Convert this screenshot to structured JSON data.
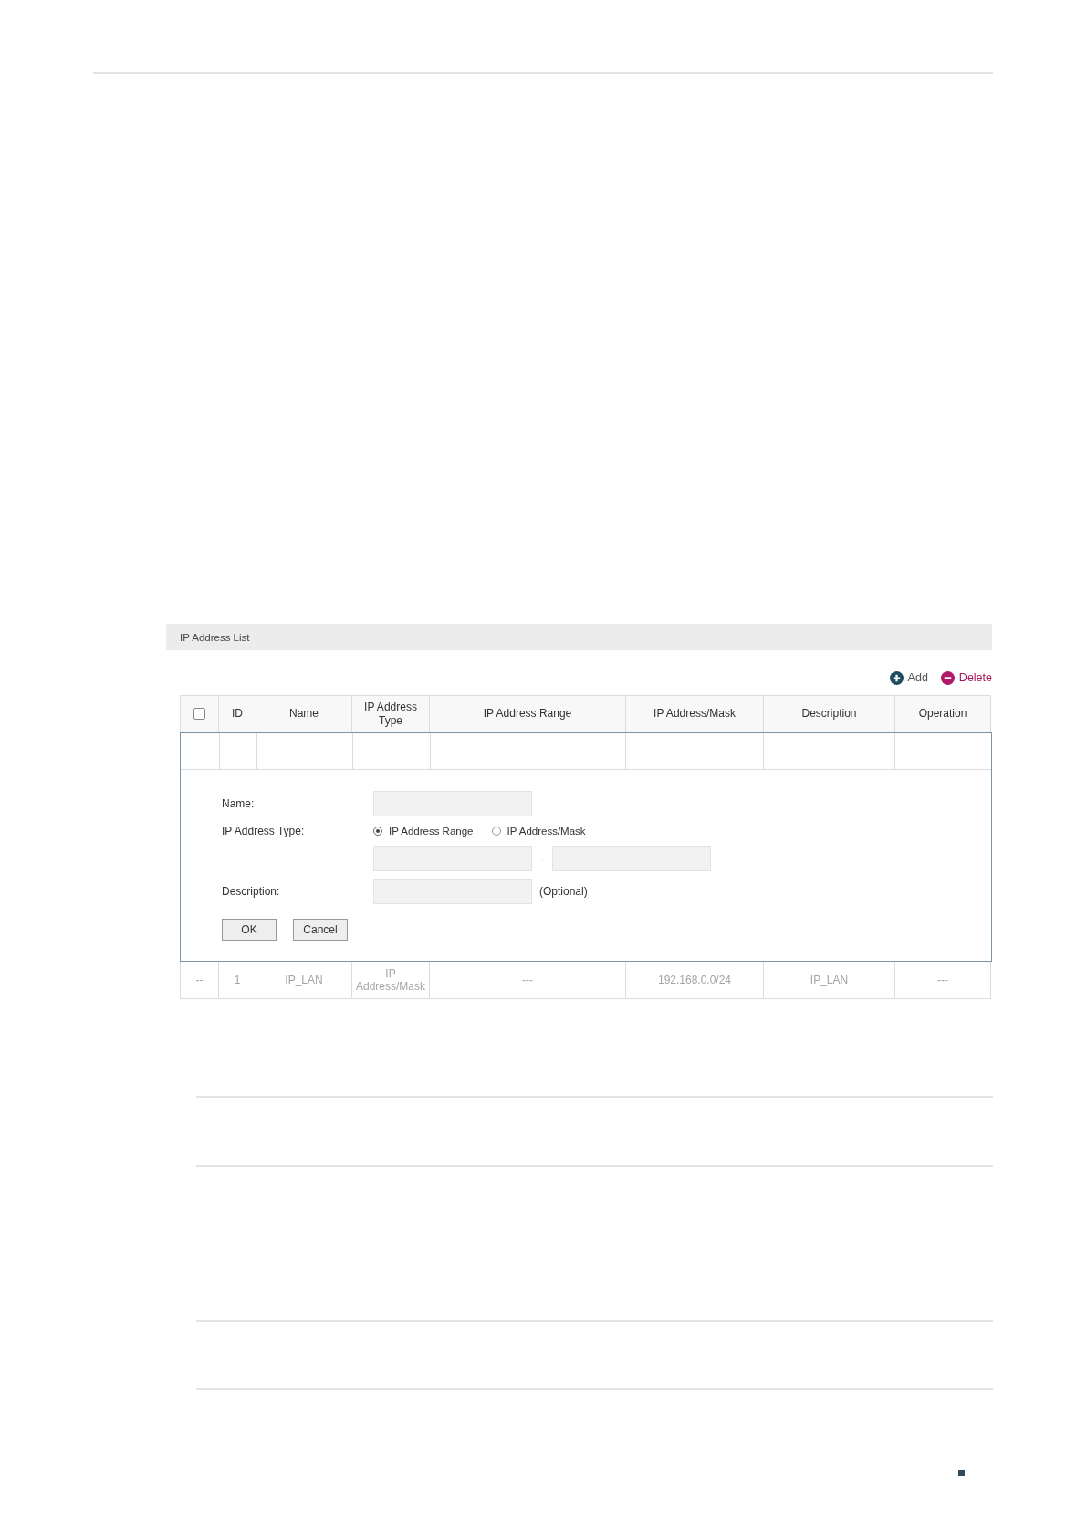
{
  "panel": {
    "title": "IP Address List"
  },
  "toolbar": [
    {
      "kind": "add",
      "label": "Add"
    },
    {
      "kind": "delete",
      "label": "Delete"
    }
  ],
  "table": {
    "columns": [
      {
        "kind": "checkbox",
        "checked": false
      },
      {
        "kind": "text",
        "label": "ID"
      },
      {
        "kind": "text",
        "label": "Name"
      },
      {
        "kind": "text",
        "label": "IP Address Type"
      },
      {
        "kind": "text",
        "label": "IP Address Range"
      },
      {
        "kind": "text",
        "label": "IP Address/Mask"
      },
      {
        "kind": "text",
        "label": "Description"
      },
      {
        "kind": "text",
        "label": "Operation"
      }
    ],
    "rows": [
      {
        "cells": [
          "--",
          "--",
          "--",
          "--",
          "--",
          "--",
          "--",
          "--"
        ]
      }
    ],
    "form": {
      "name": {
        "label": "Name:"
      },
      "type": {
        "label": "IP Address Type:",
        "options": [
          {
            "label": "IP Address Range",
            "selected": true
          },
          {
            "label": "IP Address/Mask",
            "selected": false
          }
        ],
        "separator": "-"
      },
      "description": {
        "label": "Description:",
        "hint": "(Optional)"
      },
      "buttons": [
        "OK",
        "Cancel"
      ]
    },
    "rows_after": [
      {
        "cells": [
          "--",
          "1",
          "IP_LAN",
          "IP Address/Mask",
          "---",
          "192.168.0.0/24",
          "IP_LAN",
          "---"
        ]
      }
    ]
  }
}
